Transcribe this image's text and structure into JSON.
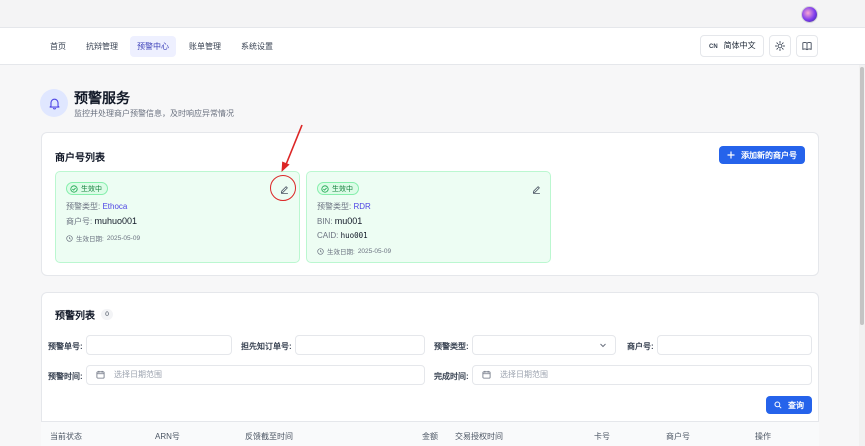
{
  "nav": {
    "items": [
      {
        "label": "首页",
        "active": false
      },
      {
        "label": "抗辩管理",
        "active": false
      },
      {
        "label": "预警中心",
        "active": true
      },
      {
        "label": "账单管理",
        "active": false
      },
      {
        "label": "系统设置",
        "active": false
      }
    ],
    "lang_code": "CN",
    "lang_label": "简体中文"
  },
  "page": {
    "title": "预警服务",
    "subtitle": "监控并处理商户预警信息，及时响应异常情况"
  },
  "merchants": {
    "title": "商户号列表",
    "add_button": "添加新的商户号",
    "cards": [
      {
        "status": "生效中",
        "type_label": "预警类型:",
        "type_value": "Ethoca",
        "lines": [
          {
            "label": "商户号:",
            "value": "muhuo001"
          }
        ],
        "date_label": "生效日期:",
        "date": "2025-05-09"
      },
      {
        "status": "生效中",
        "type_label": "预警类型:",
        "type_value": "RDR",
        "lines": [
          {
            "label": "BIN:",
            "value": "mu001"
          },
          {
            "label": "CAID:",
            "value": "huo001"
          }
        ],
        "date_label": "生效日期:",
        "date": "2025-05-09"
      }
    ]
  },
  "alerts": {
    "title": "预警列表",
    "count": "0",
    "filters": {
      "alert_no": "预警单号:",
      "prior_no": "担先知订单号:",
      "alert_type": "预警类型:",
      "merchant_no": "商户号:",
      "alert_time": "预警时间:",
      "done_time": "完成时间:",
      "date_placeholder": "选择日期范围"
    },
    "query_button": "查询",
    "columns": [
      "当前状态",
      "ARN号",
      "反馈截至时间",
      "金额",
      "交易授权时间",
      "卡号",
      "商户号",
      "操作"
    ]
  },
  "colors": {
    "primary": "#2563eb",
    "success": "#16a34a",
    "annotation": "#dc2626"
  },
  "icons": [
    "avatar",
    "sun-icon",
    "book-icon",
    "bell-icon",
    "plus-icon",
    "check-circle-icon",
    "edit-icon",
    "clock-icon",
    "calendar-icon",
    "chevron-down-icon",
    "search-icon"
  ]
}
